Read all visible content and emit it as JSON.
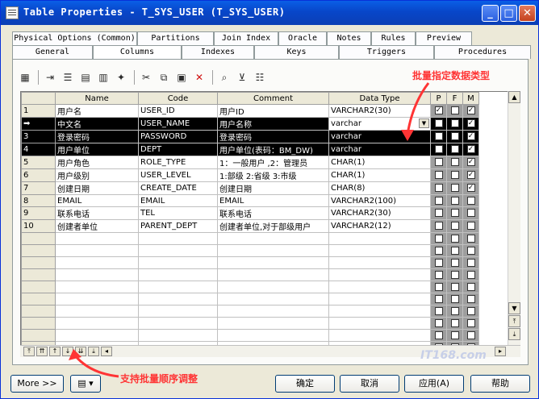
{
  "window": {
    "title": "Table Properties - T_SYS_USER (T_SYS_USER)",
    "controls": [
      "_",
      "□",
      "✕"
    ]
  },
  "tabs_back": [
    "Physical Options (Common)",
    "Partitions",
    "Join Index",
    "Oracle",
    "Notes",
    "Rules",
    "Preview"
  ],
  "tabs_front": [
    "General",
    "Columns",
    "Indexes",
    "Keys",
    "Triggers",
    "Procedures"
  ],
  "active_tab": "Columns",
  "toolbar": {
    "icons": [
      "properties-icon",
      "insert-row-icon",
      "add-row-icon",
      "add-columns-icon",
      "add-attribute-icon",
      "new-icon",
      "cut-icon",
      "copy-icon",
      "paste-icon",
      "delete-icon",
      "find-icon",
      "filter-icon",
      "customize-columns-icon"
    ]
  },
  "grid": {
    "headers": [
      "Name",
      "Code",
      "Comment",
      "Data Type",
      "P",
      "F",
      "M"
    ],
    "rows": [
      {
        "num": "1",
        "name": "用户名",
        "code": "USER_ID",
        "comment": "用户ID",
        "type": "VARCHAR2(30)",
        "p": true,
        "f": false,
        "m": true,
        "selected": false
      },
      {
        "num": "➡",
        "name": "中文名",
        "code": "USER_NAME",
        "comment": "用户名称",
        "type": "varchar",
        "p": false,
        "f": false,
        "m": true,
        "selected": true,
        "editing": true
      },
      {
        "num": "3",
        "name": "登录密码",
        "code": "PASSWORD",
        "comment": "登录密码",
        "type": "varchar",
        "p": false,
        "f": false,
        "m": true,
        "selected": true
      },
      {
        "num": "4",
        "name": "用户单位",
        "code": "DEPT",
        "comment": "用户单位(表码：BM_DW)",
        "type": "varchar",
        "p": false,
        "f": false,
        "m": true,
        "selected": true
      },
      {
        "num": "5",
        "name": "用户角色",
        "code": "ROLE_TYPE",
        "comment": "1：一般用户 ,2：管理员",
        "type": "CHAR(1)",
        "p": false,
        "f": false,
        "m": true,
        "selected": false
      },
      {
        "num": "6",
        "name": "用户级别",
        "code": "USER_LEVEL",
        "comment": "1:部级 2:省级 3:市级",
        "type": "CHAR(1)",
        "p": false,
        "f": false,
        "m": true,
        "selected": false
      },
      {
        "num": "7",
        "name": "创建日期",
        "code": "CREATE_DATE",
        "comment": "创建日期",
        "type": "CHAR(8)",
        "p": false,
        "f": false,
        "m": true,
        "selected": false
      },
      {
        "num": "8",
        "name": "EMAIL",
        "code": "EMAIL",
        "comment": "EMAIL",
        "type": "VARCHAR2(100)",
        "p": false,
        "f": false,
        "m": false,
        "selected": false
      },
      {
        "num": "9",
        "name": "联系电话",
        "code": "TEL",
        "comment": "联系电话",
        "type": "VARCHAR2(30)",
        "p": false,
        "f": false,
        "m": false,
        "selected": false
      },
      {
        "num": "10",
        "name": "创建者单位",
        "code": "PARENT_DEPT",
        "comment": "创建者单位,对于部级用户",
        "type": "VARCHAR2(12)",
        "p": false,
        "f": false,
        "m": false,
        "selected": false
      }
    ],
    "empty_rows": 10
  },
  "annotations": {
    "top": "批量指定数据类型",
    "bottom": "支持批量顺序调整"
  },
  "watermark": "IT168.com",
  "footer": {
    "more": "More >>",
    "ok": "确定",
    "cancel": "取消",
    "apply": "应用(A)",
    "help": "帮助"
  },
  "colors": {
    "titlebar": "#0a5fe6",
    "annotation": "#ff3434",
    "selected_row": "#000000"
  }
}
